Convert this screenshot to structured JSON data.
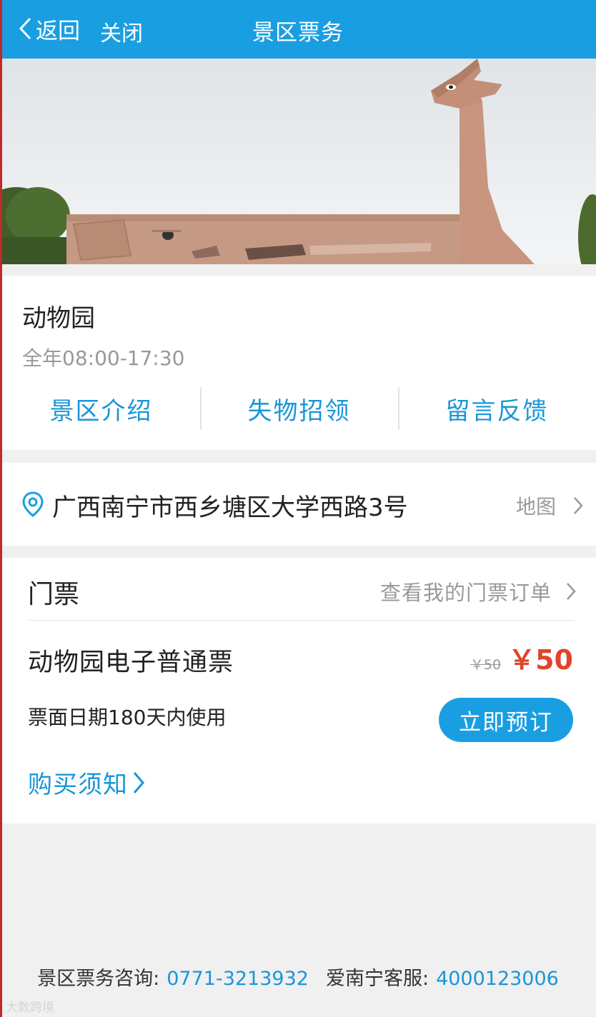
{
  "header": {
    "back_label": "返回",
    "close_label": "关闭",
    "title": "景区票务"
  },
  "banner": {
    "slides_count": 2,
    "active_slide": 1
  },
  "scenic": {
    "name": "动物园",
    "hours": "全年08:00-17:30",
    "actions": [
      "景区介绍",
      "失物招领",
      "留言反馈"
    ]
  },
  "address": {
    "text": "广西南宁市西乡塘区大学西路3号",
    "map_label": "地图"
  },
  "tickets": {
    "title": "门票",
    "orders_label": "查看我的门票订单",
    "item": {
      "name": "动物园电子普通票",
      "original_price": "￥50",
      "price": "￥50",
      "validity": "票面日期180天内使用",
      "book_label": "立即预订"
    },
    "notice_label": "购买须知"
  },
  "footer": {
    "consult_label": "景区票务咨询:",
    "consult_phone": "0771-3213932",
    "service_label": "爱南宁客服:",
    "service_phone": "4000123006"
  },
  "watermark": "大数跨境",
  "colors": {
    "header_bg": "#1a9ee2",
    "link_blue": "#1a96d8",
    "price_red": "#e0442c"
  }
}
